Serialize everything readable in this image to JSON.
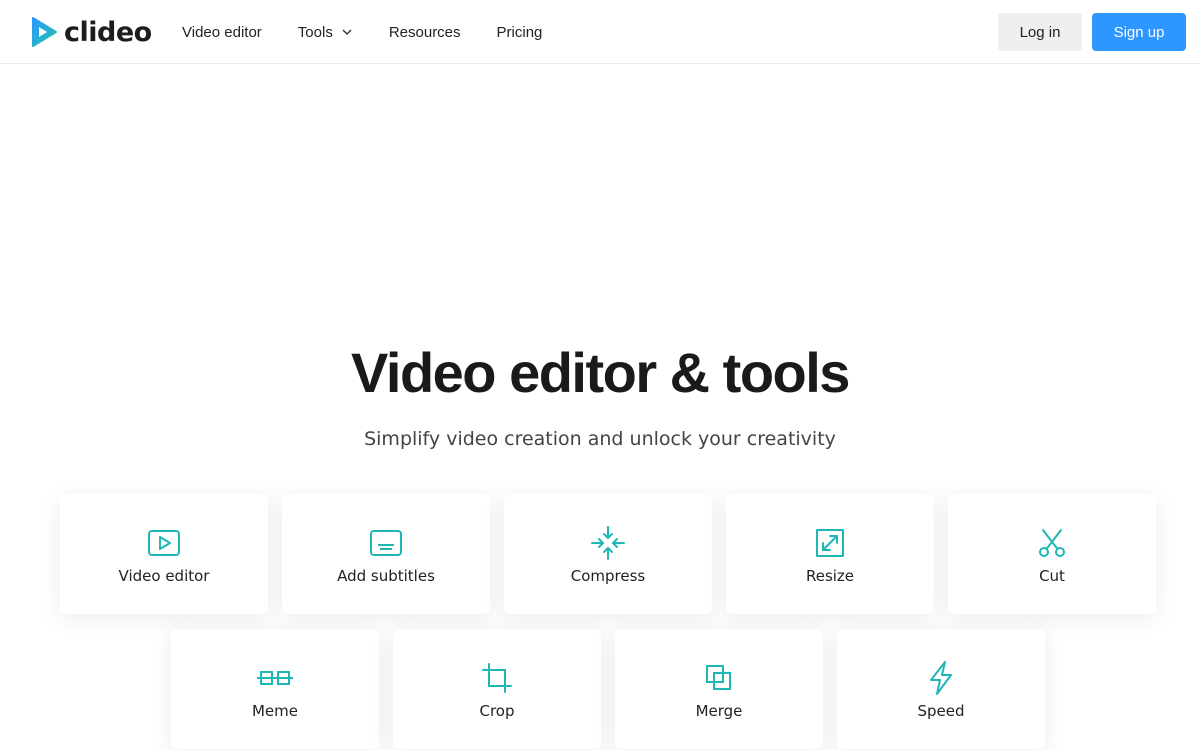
{
  "brand": {
    "name": "clideo",
    "accent": "#2d96ff",
    "icon_color": "#1fb6b6"
  },
  "nav": {
    "items": [
      {
        "label": "Video editor"
      },
      {
        "label": "Tools",
        "dropdown": true
      },
      {
        "label": "Resources"
      },
      {
        "label": "Pricing"
      }
    ]
  },
  "auth": {
    "login_label": "Log in",
    "signup_label": "Sign up"
  },
  "hero": {
    "title": "Video editor & tools",
    "subtitle": "Simplify video creation and unlock your creativity"
  },
  "tools": [
    {
      "label": "Video editor",
      "icon": "play-icon"
    },
    {
      "label": "Add subtitles",
      "icon": "subtitles-icon"
    },
    {
      "label": "Compress",
      "icon": "compress-icon"
    },
    {
      "label": "Resize",
      "icon": "resize-icon"
    },
    {
      "label": "Cut",
      "icon": "scissors-icon"
    },
    {
      "label": "Meme",
      "icon": "meme-icon"
    },
    {
      "label": "Crop",
      "icon": "crop-icon"
    },
    {
      "label": "Merge",
      "icon": "merge-icon"
    },
    {
      "label": "Speed",
      "icon": "lightning-icon"
    }
  ]
}
